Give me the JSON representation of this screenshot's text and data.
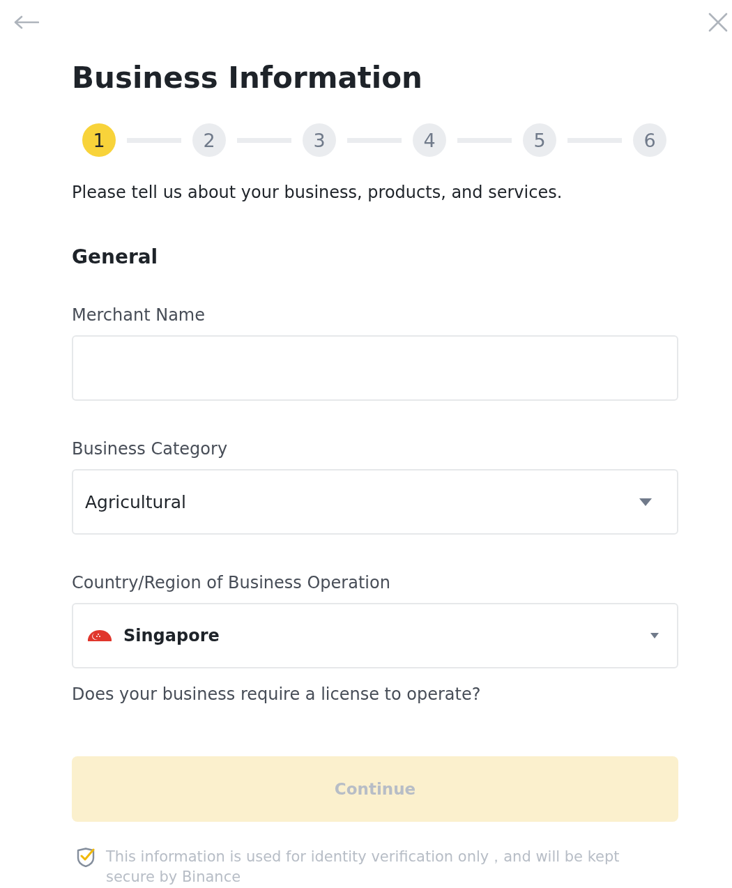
{
  "title": "Business Information",
  "steps": [
    {
      "label": "1",
      "selected": true
    },
    {
      "label": "2",
      "selected": false
    },
    {
      "label": "3",
      "selected": false
    },
    {
      "label": "4",
      "selected": false
    },
    {
      "label": "5",
      "selected": false
    },
    {
      "label": "6",
      "selected": false
    }
  ],
  "intro": "Please tell us about your business, products, and services.",
  "section": {
    "heading": "General"
  },
  "fields": [
    {
      "kind": "text",
      "label": "Merchant Name"
    },
    {
      "kind": "select",
      "label": "Business Category",
      "value": "Agricultural"
    },
    {
      "kind": "country",
      "label": "Country/Region of Business Operation",
      "value": "Singapore"
    }
  ],
  "question": "Does your business require a license to operate?",
  "continue_button": {
    "label": "Continue",
    "disabled": true
  },
  "footer_note": "This information is used for identity verification only，and will be kept secure by Binance"
}
